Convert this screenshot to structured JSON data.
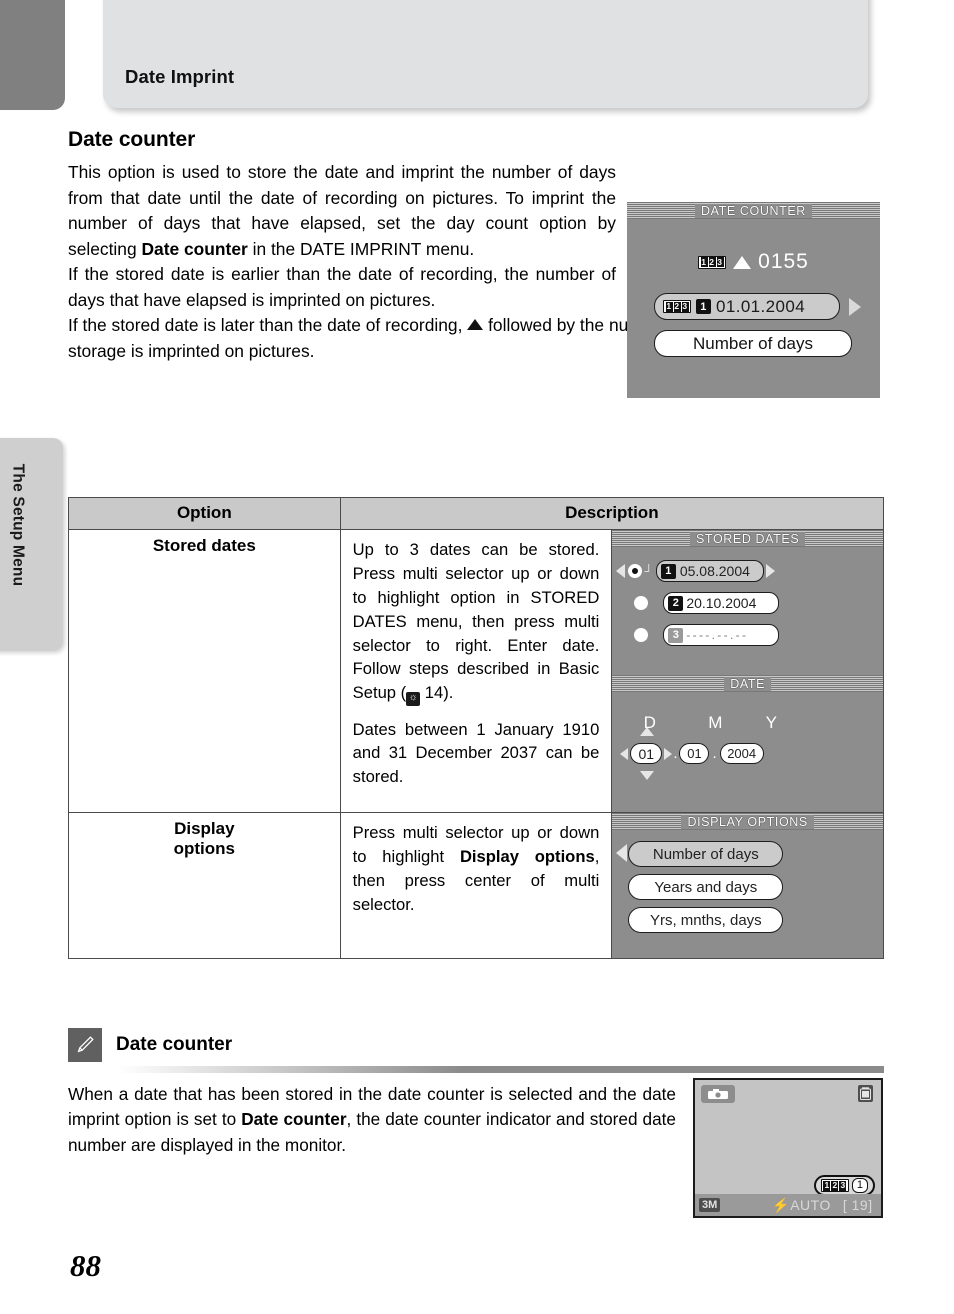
{
  "header": {
    "chapter_tab_label": "Date Imprint"
  },
  "side_tab": {
    "label": "The Setup Menu"
  },
  "section": {
    "title": "Date counter",
    "para1_a": "This option is used to store the date and imprint the number of days from that date until the date of recording on pictures. To imprint the number of days that have elapsed, set the day count option by selecting ",
    "para1_bold": "Date counter",
    "para1_b": " in the DATE IMPRINT menu.",
    "para2": "If the stored date is earlier than the date of recording, the number of days that have elapsed is imprinted on pictures.",
    "para3_a": "If the stored date is later than the date of recording, ",
    "para3_b": " followed by the number of days until the date of storage is imprinted on pictures."
  },
  "lcd_date_counter": {
    "title": "DATE COUNTER",
    "counter_icon": "counter-123-icon",
    "days_value": "0155",
    "up_triangle": "triangle-up-icon",
    "stored_slot": "1",
    "stored_date": "01.01.2004",
    "right_arrow": "triangle-right-icon",
    "display_mode": "Number of days"
  },
  "table": {
    "headers": [
      "Option",
      "Description"
    ],
    "rows": [
      {
        "option": "Stored dates",
        "desc_p1_a": "Up to 3 dates can be stored. Press multi selector up or down to highlight option in STORED DATES menu, then press multi selector to right. Enter date. Follow steps described in Basic Setup (",
        "desc_p1_ref": "14",
        "desc_p1_b": ").",
        "desc_p2": "Dates between 1 January 1910 and 31 December 2037 can be stored."
      },
      {
        "option_line1": "Display",
        "option_line2": "options",
        "desc_a": "Press multi selector up or down to highlight ",
        "desc_bold": "Display options",
        "desc_b": ", then press center of multi selector."
      }
    ]
  },
  "lcd_stored_dates": {
    "title": "STORED DATES",
    "left_arrow": "triangle-left-icon",
    "right_arrow": "triangle-right-icon",
    "items": [
      {
        "slot": "1",
        "date": "05.08.2004",
        "selected": true
      },
      {
        "slot": "2",
        "date": "20.10.2004",
        "selected": false
      },
      {
        "slot": "3",
        "date": "- - - - . - - . - -",
        "selected": false
      }
    ]
  },
  "lcd_date": {
    "title": "DATE",
    "col_labels": [
      "D",
      "M",
      "Y"
    ],
    "day": "01",
    "month": "01",
    "year": "2004",
    "sep1": ".",
    "sep2": "."
  },
  "lcd_display_options": {
    "title": "DISPLAY OPTIONS",
    "cursor": "triangle-left-icon",
    "items": [
      "Number of days",
      "Years and days",
      "Yrs, mnths, days"
    ]
  },
  "note": {
    "icon": "pencil-icon",
    "title": "Date counter",
    "body_a": "When a date that has been stored in the date counter is selected and the date imprint option is set to ",
    "body_bold": "Date counter",
    "body_b": ", the date counter indicator and stored date number are displayed in the monitor."
  },
  "lcd_monitor": {
    "camera_icon": "camera-mode-icon",
    "battery_icon": "battery-icon",
    "image_size": "3M",
    "flash_icon": "flash-icon",
    "flash_mode": "AUTO",
    "frames_remaining": "[ 19]",
    "counter_icon": "counter-123-icon",
    "stored_slot": "1"
  },
  "footer": {
    "page_number": "88"
  },
  "colors": {
    "page_bg": "#ffffff",
    "header_tab_dark": "#808080",
    "header_bar": "#e0e1e3",
    "side_tab": "#cfcfcf",
    "table_header_bg": "#c9c9c9",
    "lcd_bg": "#8d8d8d",
    "note_icon_bg": "#606060"
  }
}
